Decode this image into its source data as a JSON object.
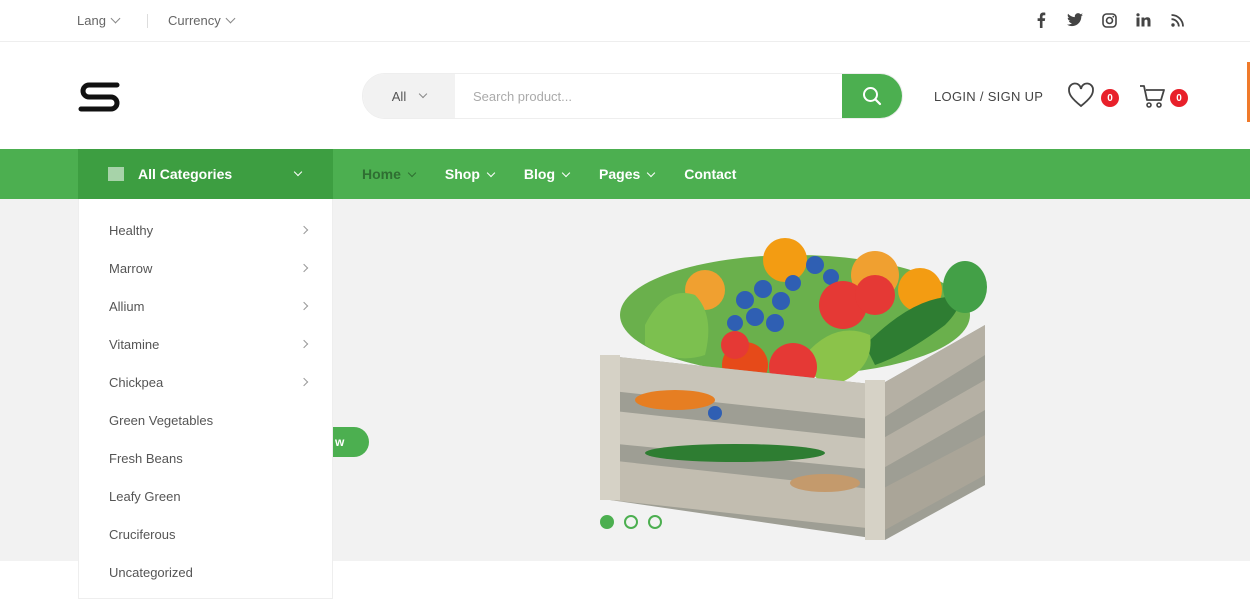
{
  "topbar": {
    "lang_label": "Lang",
    "currency_label": "Currency",
    "social_icons": [
      "facebook-icon",
      "twitter-icon",
      "instagram-icon",
      "linkedin-icon",
      "rss-icon"
    ]
  },
  "header": {
    "logo_text": "S",
    "search": {
      "category_label": "All",
      "placeholder": "Search product..."
    },
    "login_label": "LOGIN / SIGN UP",
    "wishlist_count": "0",
    "cart_count": "0"
  },
  "nav": {
    "all_categories_label": "All Categories",
    "links": [
      {
        "label": "Home",
        "has_dropdown": true
      },
      {
        "label": "Shop",
        "has_dropdown": true
      },
      {
        "label": "Blog",
        "has_dropdown": true
      },
      {
        "label": "Pages",
        "has_dropdown": true
      },
      {
        "label": "Contact",
        "has_dropdown": false
      }
    ]
  },
  "categories": [
    {
      "label": "Healthy",
      "has_sub": true
    },
    {
      "label": "Marrow",
      "has_sub": true
    },
    {
      "label": "Allium",
      "has_sub": true
    },
    {
      "label": "Vitamine",
      "has_sub": true
    },
    {
      "label": "Chickpea",
      "has_sub": true
    },
    {
      "label": "Green Vegetables",
      "has_sub": false
    },
    {
      "label": "Fresh Beans",
      "has_sub": false
    },
    {
      "label": "Leafy Green",
      "has_sub": false
    },
    {
      "label": "Cruciferous",
      "has_sub": false
    },
    {
      "label": "Uncategorized",
      "has_sub": false
    }
  ],
  "hero": {
    "button_label": "w",
    "slide_count": 3,
    "active_slide": 1
  },
  "colors": {
    "primary_green": "#4caf50",
    "dark_green": "#3d9e41",
    "badge_red": "#e8202a"
  }
}
